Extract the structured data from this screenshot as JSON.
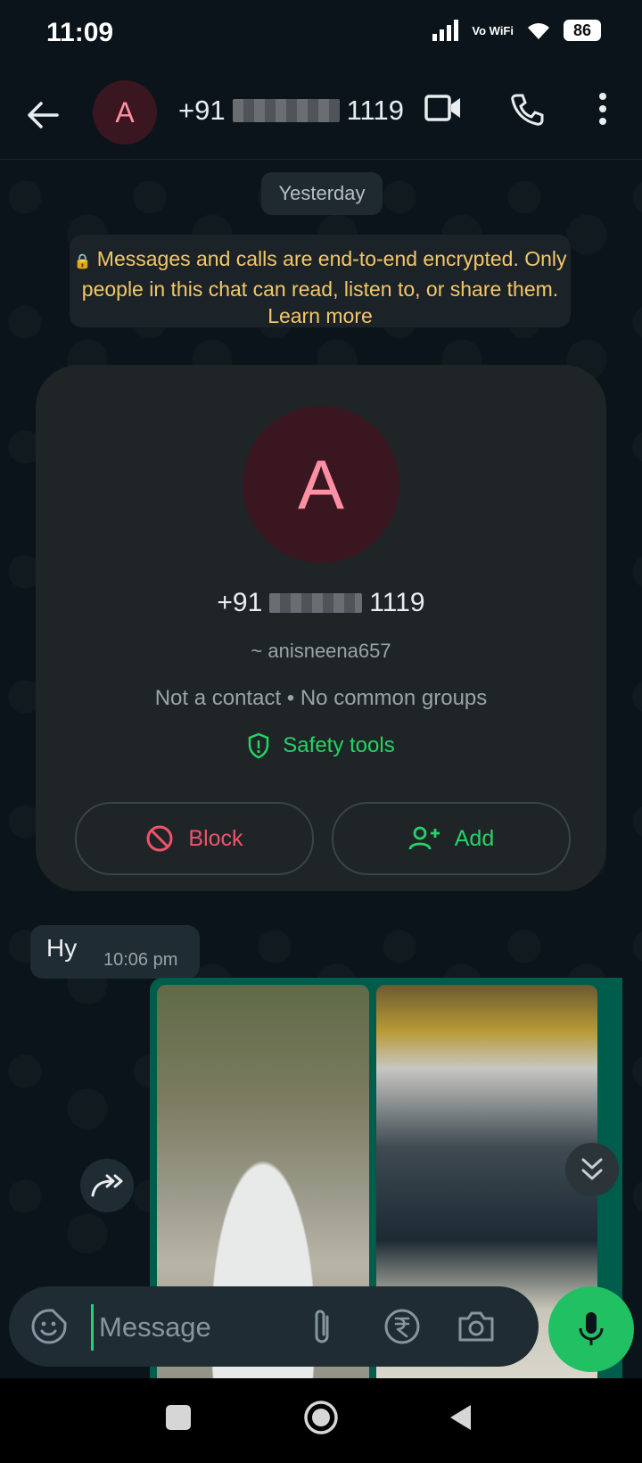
{
  "status_bar": {
    "time": "11:09",
    "network": "Vo WiFi",
    "battery": "86"
  },
  "header": {
    "avatar_letter": "A",
    "title_prefix": "+91",
    "title_suffix": "1119"
  },
  "chat": {
    "date_chip": "Yesterday",
    "encryption_notice": "Messages and calls are end-to-end encrypted. Only people in this chat can read, listen to, or share them.",
    "learn_more": "Learn more"
  },
  "contact_card": {
    "avatar_letter": "A",
    "phone_prefix": "+91",
    "phone_suffix": "1119",
    "username": "~ anisneena657",
    "meta": "Not a contact  •  No common groups",
    "safety_tools": "Safety tools",
    "block_label": "Block",
    "add_label": "Add"
  },
  "messages": [
    {
      "text": "Hy",
      "time": "10:06 pm",
      "direction": "incoming"
    }
  ],
  "composer": {
    "placeholder": "Message"
  },
  "colors": {
    "accent_green": "#25d366",
    "block_red": "#f1526b",
    "notice_yellow": "#f3c769"
  }
}
